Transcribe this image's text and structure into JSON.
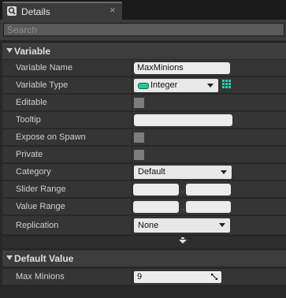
{
  "tab": {
    "title": "Details",
    "icon": "details-magnifier-icon",
    "close": "×"
  },
  "search": {
    "placeholder": "Search"
  },
  "variable_section": {
    "title": "Variable",
    "rows": {
      "variable_name": {
        "label": "Variable Name",
        "value": "MaxMinions"
      },
      "variable_type": {
        "label": "Variable Type",
        "value": "Integer",
        "type_color": "#1fc7a4"
      },
      "editable": {
        "label": "Editable",
        "checked": false
      },
      "tooltip": {
        "label": "Tooltip",
        "value": ""
      },
      "expose_on_spawn": {
        "label": "Expose on Spawn",
        "checked": false
      },
      "private": {
        "label": "Private",
        "checked": false
      },
      "category": {
        "label": "Category",
        "value": "Default"
      },
      "slider_range": {
        "label": "Slider Range",
        "min": "",
        "max": ""
      },
      "value_range": {
        "label": "Value Range",
        "min": "",
        "max": ""
      },
      "replication": {
        "label": "Replication",
        "value": "None"
      }
    }
  },
  "default_value_section": {
    "title": "Default Value",
    "rows": {
      "max_minions": {
        "label": "Max Minions",
        "value": "9"
      }
    }
  }
}
